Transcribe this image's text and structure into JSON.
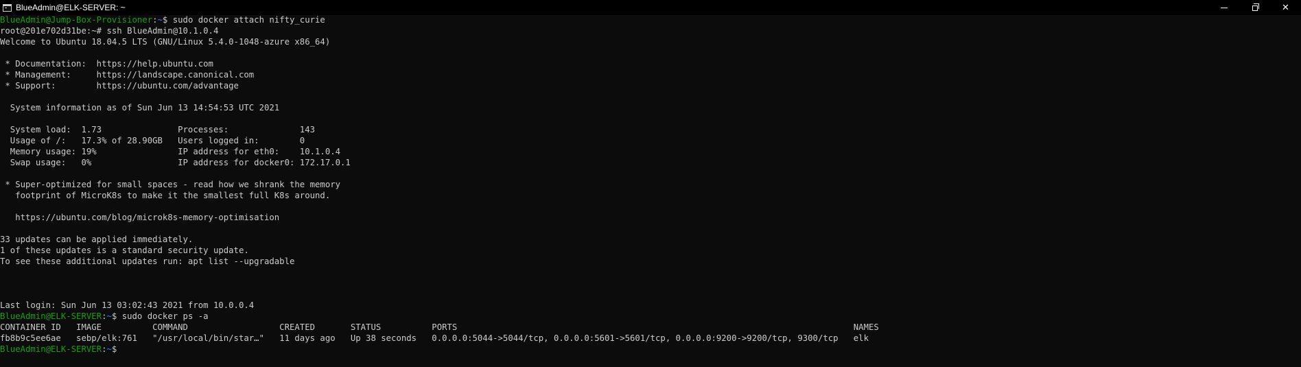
{
  "window": {
    "title": "BlueAdmin@ELK-SERVER: ~",
    "icon": "terminal-app-icon",
    "controls": {
      "minimize": "minimize-icon",
      "restore": "restore-icon",
      "close": "close-icon",
      "close_glyph": "✕"
    }
  },
  "colors": {
    "background": "#0c0c0c",
    "text": "#cccccc",
    "prompt_user": "#13a10e",
    "prompt_path": "#3b78ff"
  },
  "terminal": {
    "lines": [
      {
        "user": "BlueAdmin@Jump-Box-Provisioner",
        "sep": ":",
        "path": "~",
        "text": "$ sudo docker attach nifty_curie"
      },
      {
        "text": "root@201e702d31be:~# ssh BlueAdmin@10.1.0.4"
      },
      {
        "text": "Welcome to Ubuntu 18.04.5 LTS (GNU/Linux 5.4.0-1048-azure x86_64)"
      },
      {
        "text": ""
      },
      {
        "text": " * Documentation:  https://help.ubuntu.com"
      },
      {
        "text": " * Management:     https://landscape.canonical.com"
      },
      {
        "text": " * Support:        https://ubuntu.com/advantage"
      },
      {
        "text": ""
      },
      {
        "text": "  System information as of Sun Jun 13 14:54:53 UTC 2021"
      },
      {
        "text": ""
      },
      {
        "text": "  System load:  1.73               Processes:              143"
      },
      {
        "text": "  Usage of /:   17.3% of 28.90GB   Users logged in:        0"
      },
      {
        "text": "  Memory usage: 19%                IP address for eth0:    10.1.0.4"
      },
      {
        "text": "  Swap usage:   0%                 IP address for docker0: 172.17.0.1"
      },
      {
        "text": ""
      },
      {
        "text": " * Super-optimized for small spaces - read how we shrank the memory"
      },
      {
        "text": "   footprint of MicroK8s to make it the smallest full K8s around."
      },
      {
        "text": ""
      },
      {
        "text": "   https://ubuntu.com/blog/microk8s-memory-optimisation"
      },
      {
        "text": ""
      },
      {
        "text": "33 updates can be applied immediately."
      },
      {
        "text": "1 of these updates is a standard security update."
      },
      {
        "text": "To see these additional updates run: apt list --upgradable"
      },
      {
        "text": ""
      },
      {
        "text": ""
      },
      {
        "text": ""
      },
      {
        "text": "Last login: Sun Jun 13 03:02:43 2021 from 10.0.0.4"
      },
      {
        "user": "BlueAdmin@ELK-SERVER",
        "sep": ":",
        "path": "~",
        "text": "$ sudo docker ps -a"
      },
      {
        "text": "CONTAINER ID   IMAGE          COMMAND                  CREATED       STATUS          PORTS                                                                              NAMES"
      },
      {
        "text": "fb8b9c5ee6ae   sebp/elk:761   \"/usr/local/bin/star…\"   11 days ago   Up 38 seconds   0.0.0.0:5044->5044/tcp, 0.0.0.0:5601->5601/tcp, 0.0.0.0:9200->9200/tcp, 9300/tcp   elk"
      },
      {
        "user": "BlueAdmin@ELK-SERVER",
        "sep": ":",
        "path": "~",
        "text": "$"
      }
    ]
  }
}
